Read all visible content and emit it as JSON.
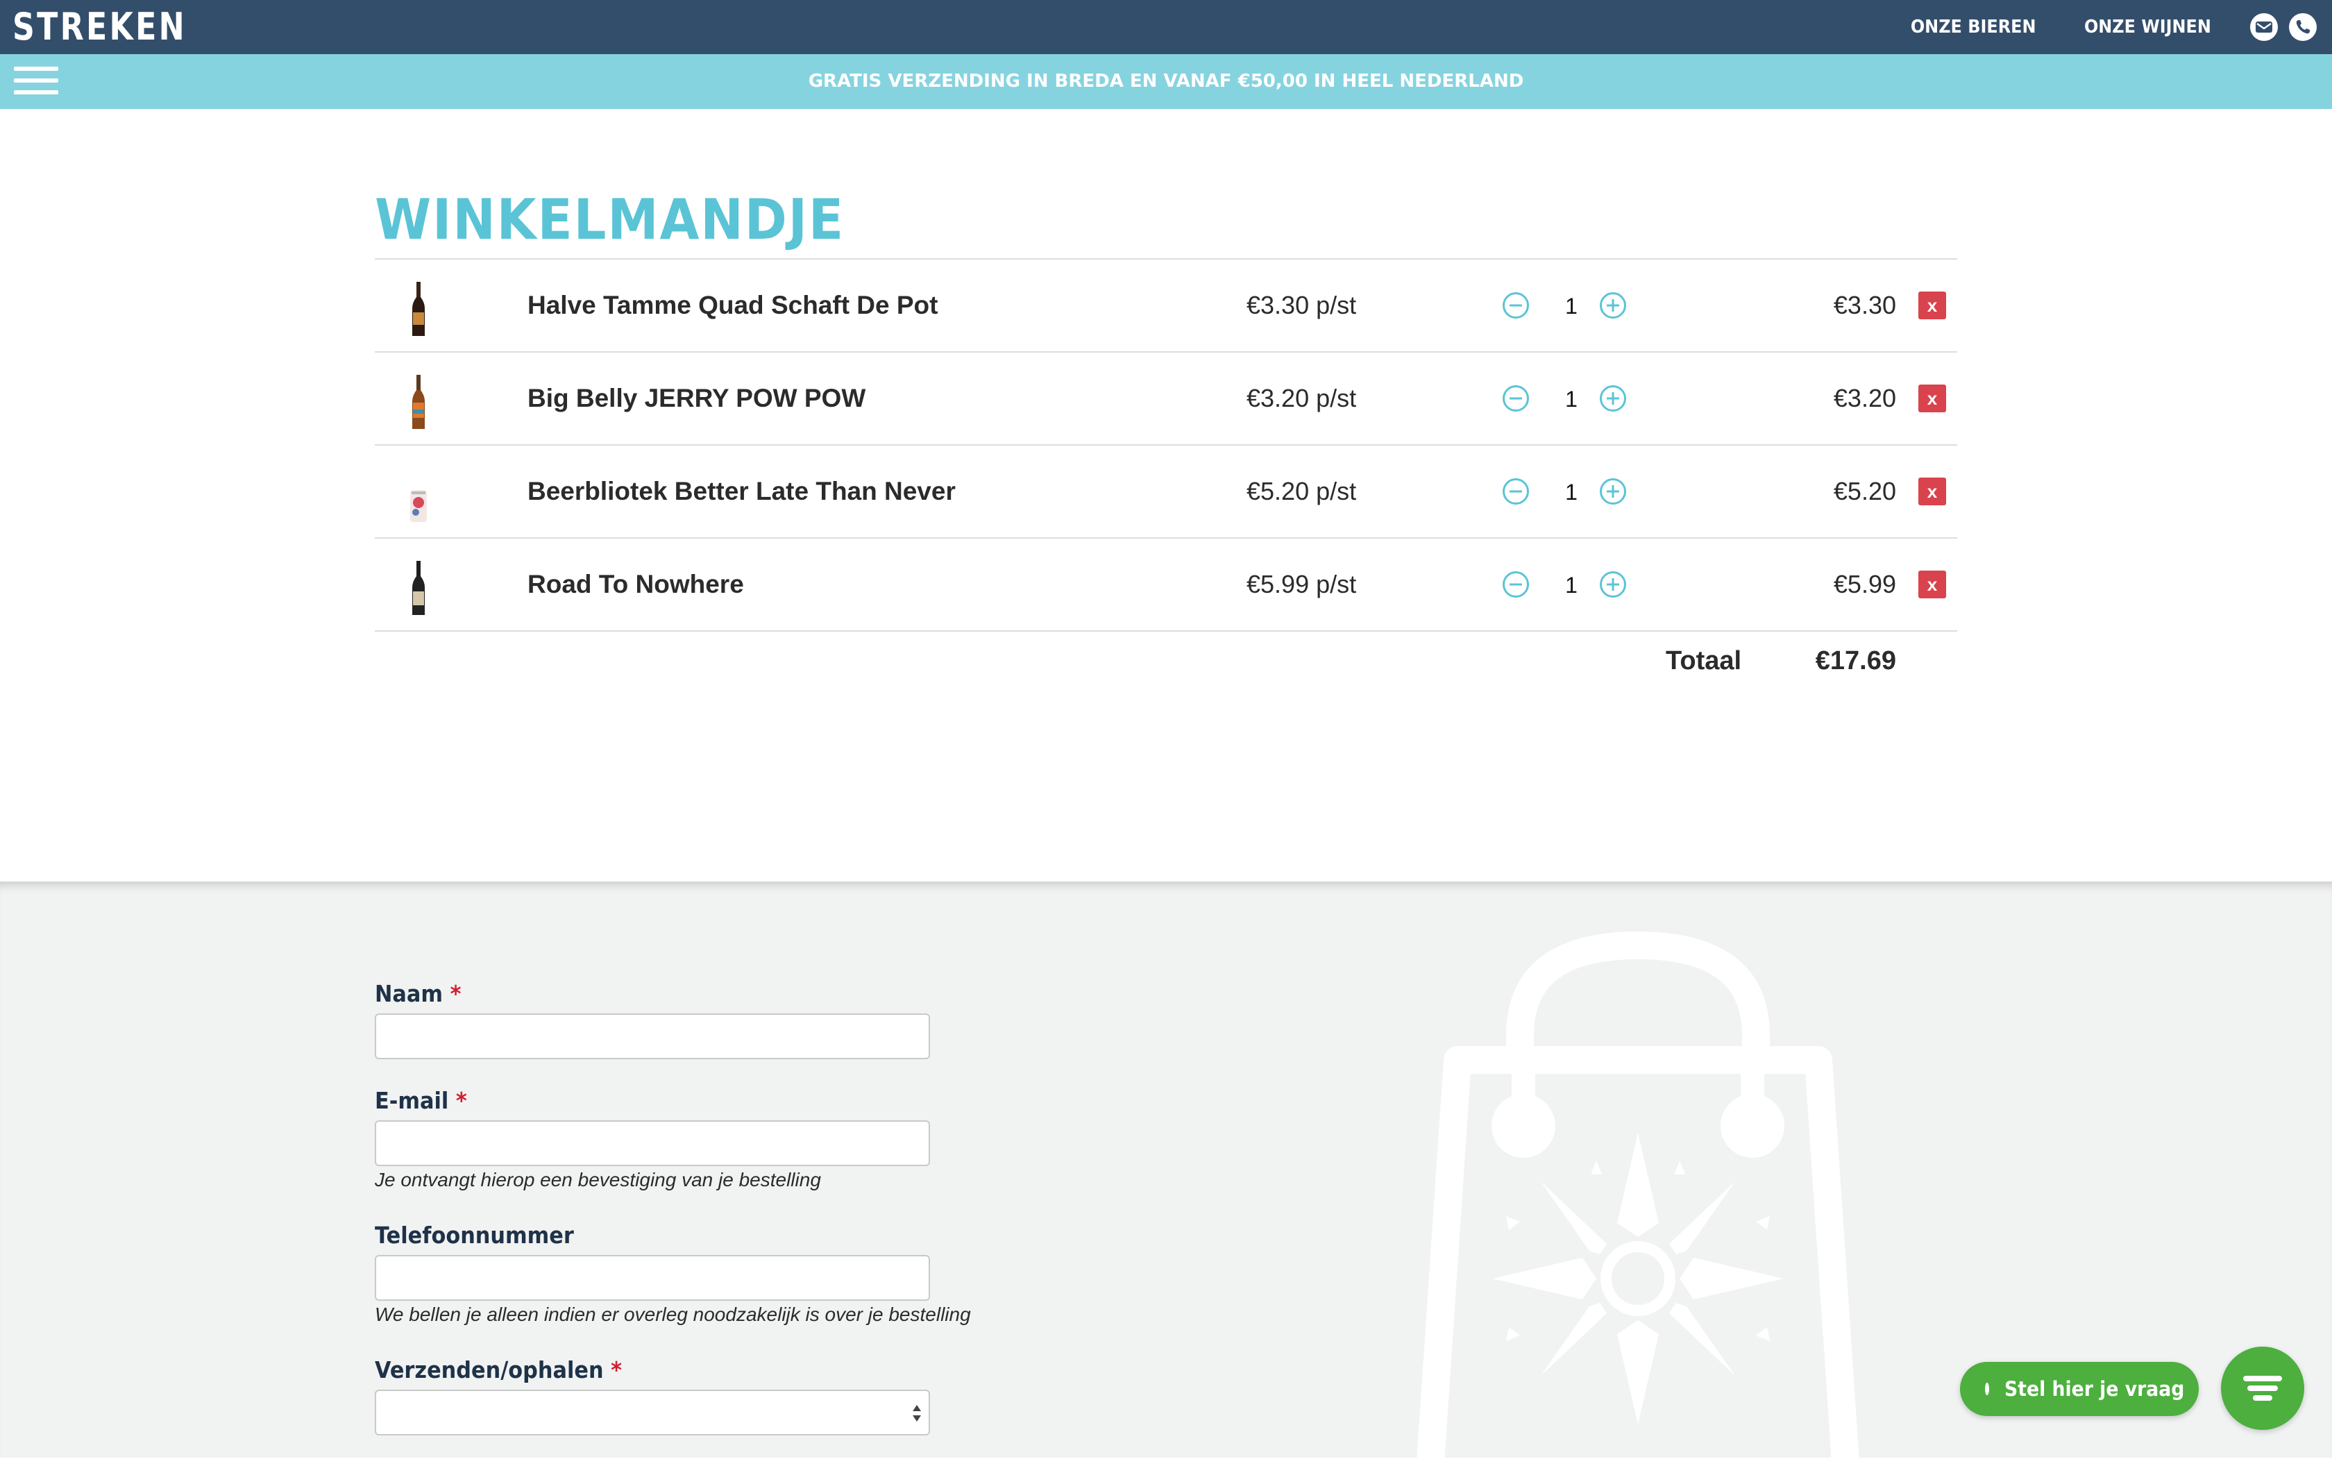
{
  "header": {
    "logo": "STREKEN",
    "nav": [
      {
        "label": "ONZE BIEREN"
      },
      {
        "label": "ONZE WIJNEN"
      }
    ],
    "icons": [
      "mail-icon",
      "phone-icon"
    ]
  },
  "banner": {
    "text": "GRATIS VERZENDING IN BREDA EN VANAF €50,00 IN HEEL NEDERLAND",
    "menu_icon": "hamburger-icon"
  },
  "cart": {
    "title": "WINKELMANDJE",
    "items": [
      {
        "name": "Halve Tamme Quad Schaft De Pot",
        "unit_price": "€3.30 p/st",
        "qty": "1",
        "line_total": "€3.30",
        "remove": "x"
      },
      {
        "name": "Big Belly JERRY POW POW",
        "unit_price": "€3.20 p/st",
        "qty": "1",
        "line_total": "€3.20",
        "remove": "x"
      },
      {
        "name": "Beerbliotek Better Late Than Never",
        "unit_price": "€5.20 p/st",
        "qty": "1",
        "line_total": "€5.20",
        "remove": "x"
      },
      {
        "name": "Road To Nowhere",
        "unit_price": "€5.99 p/st",
        "qty": "1",
        "line_total": "€5.99",
        "remove": "x"
      }
    ],
    "total_label": "Totaal",
    "total_value": "€17.69"
  },
  "form": {
    "required_mark": "*",
    "naam": {
      "label": "Naam",
      "value": ""
    },
    "email": {
      "label": "E-mail",
      "value": "",
      "help": "Je ontvangt hierop een bevestiging van je bestelling"
    },
    "telefoon": {
      "label": "Telefoonnummer",
      "value": "",
      "help": "We bellen je alleen indien er overleg noodzakelijk is over je bestelling"
    },
    "verzenden": {
      "label": "Verzenden/ophalen",
      "selected": ""
    }
  },
  "chat": {
    "label": "Stel hier je vraag"
  },
  "colors": {
    "header_bg": "#334e6b",
    "banner_bg": "#86d3e0",
    "title": "#5ac4d6",
    "remove_button": "#d9434d",
    "chat": "#4caf3e"
  }
}
